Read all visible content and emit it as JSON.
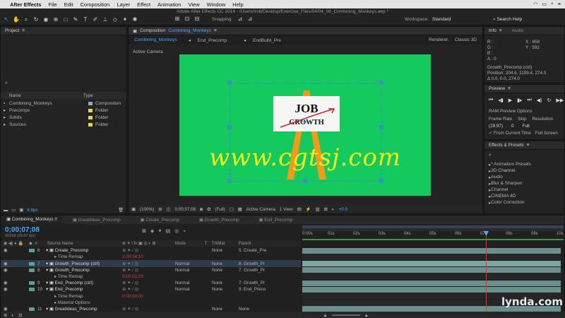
{
  "menubar": {
    "app_name": "After Effects",
    "items": [
      "File",
      "Edit",
      "Composition",
      "Layer",
      "Effect",
      "Animation",
      "View",
      "Window",
      "Help"
    ]
  },
  "window": {
    "title": "Adobe After Effects CC 2014 - /Users/irob/Desktop/Exercise_Files/04/04_06_Combining_Monkeys.aep *",
    "snapping": "Snapping",
    "workspace_label": "Workspace:",
    "workspace_value": "Standard",
    "search_help": "Search Help"
  },
  "project": {
    "tab": "Project",
    "col_name": "Name",
    "col_type": "Type",
    "items": [
      {
        "name": "Combining_Monkeys",
        "type": "Composition",
        "color": "#9aa6b4"
      },
      {
        "name": "Precomps",
        "type": "Folder",
        "color": "#e3d84a"
      },
      {
        "name": "Solids",
        "type": "Folder",
        "color": "#e3d84a"
      },
      {
        "name": "Sources",
        "type": "Folder",
        "color": "#e3d84a"
      }
    ],
    "bpc": "8 bpc"
  },
  "composition": {
    "tab": "Composition",
    "tab_name": "Combining_Monkeys",
    "breadcrumbs": [
      "Combining_Monkeys",
      "End_Precomp",
      "EndBuild_Pre"
    ],
    "renderer_label": "Renderer:",
    "renderer_value": "Classic 3D",
    "camera": "Active Camera",
    "footer": {
      "zoom": "(100%)",
      "timecode": "0;00;07;08",
      "resolution": "(Full)",
      "camera": "Active Camera",
      "view": "1 View",
      "exposure": "+0.0"
    },
    "logo_top": "JOB",
    "logo_bottom": "GROWTH",
    "canvas_color": "#14c95e"
  },
  "info": {
    "tab": "Info",
    "tab2": "Audio",
    "r": "R :",
    "g": "G :",
    "b": "B :",
    "a": "A : 0",
    "x": "X : 658",
    "y": "Y : 592",
    "layer": "Growth_Precomp (ctrl)",
    "position": "Position: 204.6, 1199.4, 274.0",
    "delta": "Δ 0.0, 0.0, 274.0"
  },
  "preview": {
    "tab": "Preview",
    "options": "RAM Preview Options",
    "frame_rate_label": "Frame Rate",
    "skip_label": "Skip",
    "resolution_label": "Resolution",
    "frame_rate": "(29.97)",
    "skip": "0",
    "resolution": "Full",
    "from_current": "From Current Time",
    "full_screen": "Full Screen"
  },
  "effects": {
    "tab": "Effects & Presets",
    "items": [
      "* Animation Presets",
      "3D Channel",
      "Audio",
      "Blur & Sharpen",
      "Channel",
      "CINEMA 4D",
      "Color Correction"
    ]
  },
  "timeline": {
    "tabs": [
      "Combining_Monkeys",
      "GreatIdeas_Precomp",
      "Create_Precomp",
      "Growth_Precomp",
      "End_Precomp"
    ],
    "timecode": "0;00;07;08",
    "frames": "00218 (29.97 fps)",
    "col_source": "Source Name",
    "col_mode": "Mode",
    "col_t": "T",
    "col_trkmat": "TrkMat",
    "col_parent": "Parent",
    "ruler": [
      "0:00s",
      "01s",
      "02s",
      "03s",
      "04s",
      "05s",
      "06s",
      "07s",
      "08s",
      "09s",
      "10s"
    ],
    "rows": [
      {
        "num": "6",
        "name": "Create_Precomp",
        "mode": "",
        "trkmat": "None",
        "parent": "5. Create_Pre"
      },
      {
        "num": "",
        "name": "Time Remap",
        "mode": "",
        "trkmat": "",
        "parent": "",
        "value": "0;00;04;10"
      },
      {
        "num": "7",
        "name": "Growth_Precomp (ctrl)",
        "mode": "Normal",
        "trkmat": "None",
        "parent": "8. Growth_Pr"
      },
      {
        "num": "8",
        "name": "Growth_Precomp",
        "mode": "Normal",
        "trkmat": "None",
        "parent": "7. Growth_Pr"
      },
      {
        "num": "",
        "name": "Time Remap",
        "mode": "",
        "trkmat": "",
        "parent": "",
        "value": "0;00;01;29"
      },
      {
        "num": "9",
        "name": "End_Precomp (ctrl)",
        "mode": "Normal",
        "trkmat": "None",
        "parent": "7. Growth_Pr"
      },
      {
        "num": "10",
        "name": "End_Precomp",
        "mode": "Normal",
        "trkmat": "None",
        "parent": "9. End_Preco"
      },
      {
        "num": "",
        "name": "Time Remap",
        "mode": "",
        "trkmat": "",
        "parent": "",
        "value": "0;00;00;00"
      },
      {
        "num": "",
        "name": "Material Options",
        "mode": "",
        "trkmat": "",
        "parent": ""
      },
      {
        "num": "11",
        "name": "GreatIdeas_Precomp",
        "mode": "",
        "trkmat": "None",
        "parent": "None"
      }
    ]
  },
  "watermark": "www.cgtsj.com",
  "brand": "lynda.com"
}
